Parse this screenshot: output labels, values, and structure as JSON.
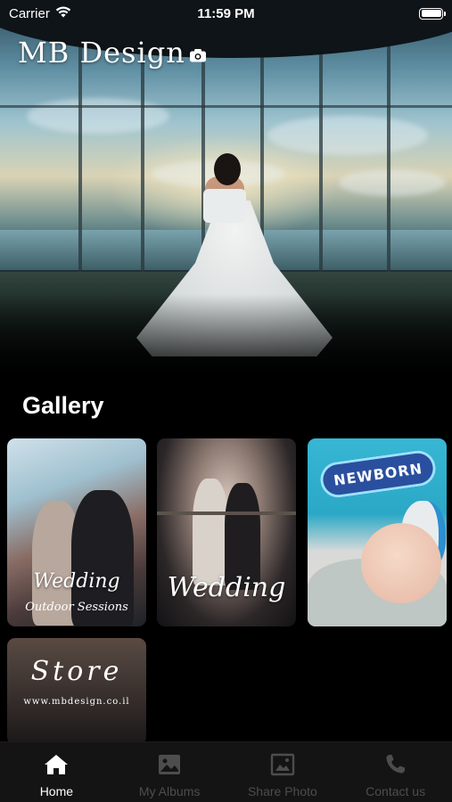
{
  "status_bar": {
    "carrier": "Carrier",
    "time": "11:59 PM"
  },
  "header": {
    "logo_main": "MB Design",
    "logo_icon": "camera-icon"
  },
  "gallery": {
    "title": "Gallery",
    "cards": [
      {
        "title": "Wedding",
        "subtitle": "Outdoor Sessions"
      },
      {
        "title": "Wedding"
      },
      {
        "title": "NEWBORN"
      },
      {
        "title": "Store",
        "subtitle": "www.mbdesign.co.il"
      }
    ]
  },
  "tab_bar": {
    "active_index": 0,
    "active_color": "#ffffff",
    "inactive_color": "#4d4d4d",
    "items": [
      {
        "label": "Home",
        "icon": "home-icon"
      },
      {
        "label": "My Albums",
        "icon": "image-icon"
      },
      {
        "label": "Share Photo",
        "icon": "photo-frame-icon"
      },
      {
        "label": "Contact us",
        "icon": "phone-icon"
      }
    ]
  }
}
